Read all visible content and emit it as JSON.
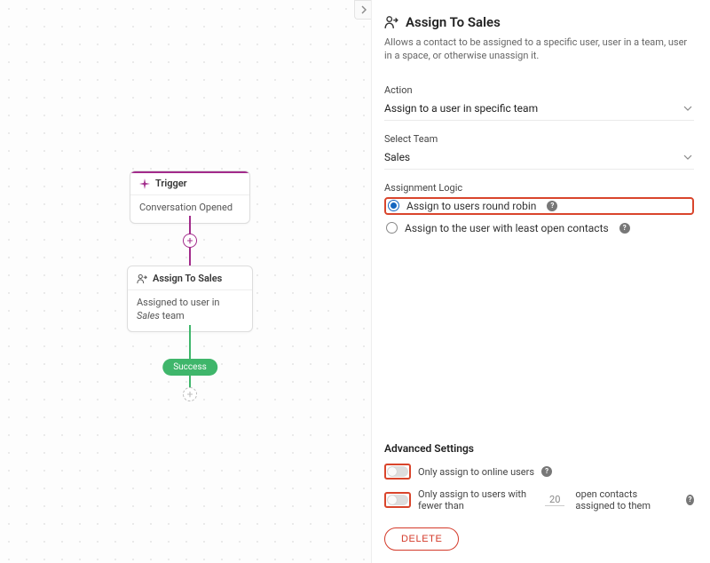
{
  "canvas": {
    "trigger": {
      "title": "Trigger",
      "body": "Conversation Opened"
    },
    "assign_node": {
      "title": "Assign To Sales",
      "body_prefix": "Assigned to user in ",
      "body_team": "Sales",
      "body_suffix": " team"
    },
    "success_label": "Success"
  },
  "panel": {
    "title": "Assign To Sales",
    "description": "Allows a contact to be assigned to a specific user, user in a team, user in a space, or otherwise unassign it.",
    "action": {
      "label": "Action",
      "value": "Assign to a user in specific team"
    },
    "team": {
      "label": "Select Team",
      "value": "Sales"
    },
    "logic": {
      "label": "Assignment Logic",
      "opt_round_robin": "Assign to users round robin",
      "opt_least_open": "Assign to the user with least open contacts"
    },
    "advanced": {
      "title": "Advanced Settings",
      "only_online": "Only assign to online users",
      "fewer_prefix": "Only assign to users with fewer than",
      "fewer_value": "20",
      "fewer_suffix": "open contacts assigned to them"
    },
    "delete": "DELETE"
  }
}
